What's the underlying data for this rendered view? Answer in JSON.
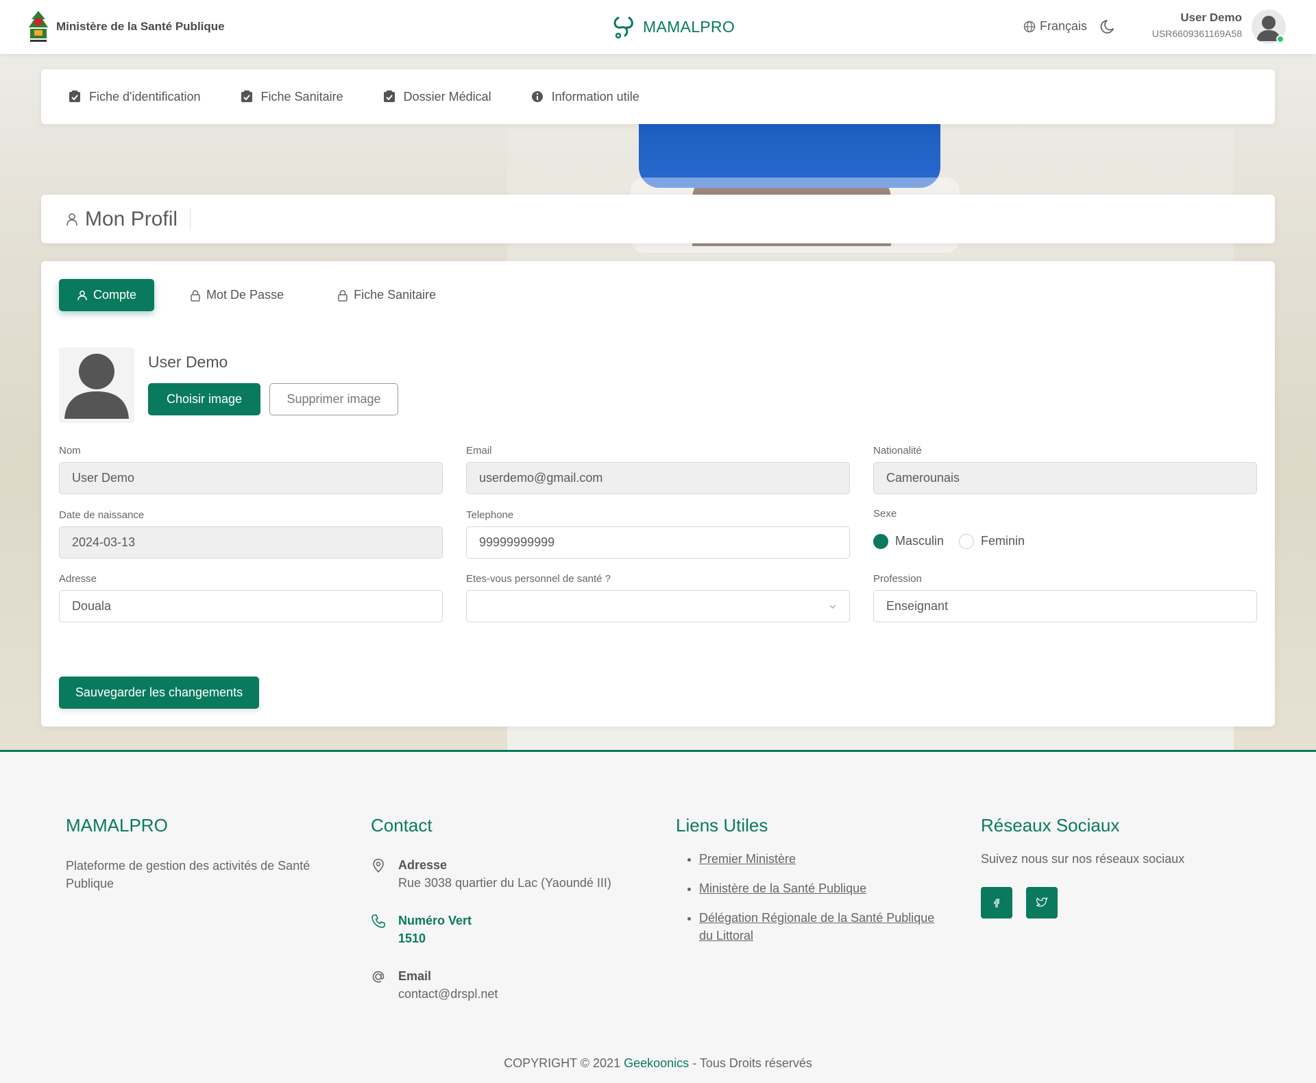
{
  "header": {
    "ministry": "Ministère de la Santé Publique",
    "brand": "MAMALPRO",
    "language": "Français",
    "user_name": "User Demo",
    "user_id": "USR6609361169A58"
  },
  "nav": [
    {
      "label": "Fiche d'identification",
      "icon": "check-square-icon"
    },
    {
      "label": "Fiche Sanitaire",
      "icon": "check-square-icon"
    },
    {
      "label": "Dossier Médical",
      "icon": "check-square-icon"
    },
    {
      "label": "Information utile",
      "icon": "info-icon"
    }
  ],
  "page_title": "Mon Profil",
  "tabs": [
    {
      "label": "Compte",
      "active": true,
      "icon": "user-icon"
    },
    {
      "label": "Mot De Passe",
      "active": false,
      "icon": "lock-icon"
    },
    {
      "label": "Fiche Sanitaire",
      "active": false,
      "icon": "lock-icon"
    }
  ],
  "profile": {
    "name": "User Demo",
    "choose_image": "Choisir image",
    "remove_image": "Supprimer image"
  },
  "form": {
    "nom": {
      "label": "Nom",
      "value": "User Demo"
    },
    "email": {
      "label": "Email",
      "value": "userdemo@gmail.com"
    },
    "nationalite": {
      "label": "Nationalité",
      "value": "Camerounais"
    },
    "naissance": {
      "label": "Date de naissance",
      "value": "2024-03-13"
    },
    "telephone": {
      "label": "Telephone",
      "value": "99999999999"
    },
    "sexe": {
      "label": "Sexe",
      "options": [
        "Masculin",
        "Feminin"
      ],
      "selected": "Masculin"
    },
    "adresse": {
      "label": "Adresse",
      "value": "Douala"
    },
    "personnel": {
      "label": "Etes-vous personnel de santé ?",
      "value": ""
    },
    "profession": {
      "label": "Profession",
      "value": "Enseignant"
    }
  },
  "save_button": "Sauvegarder les changements",
  "footer": {
    "about_title": "MAMALPRO",
    "about_text": "Plateforme de gestion des activités de Santé Publique",
    "contact_title": "Contact",
    "address_label": "Adresse",
    "address_value": "Rue 3038 quartier du Lac (Yaoundé III)",
    "phone_label": "Numéro Vert",
    "phone_value": "1510",
    "email_label": "Email",
    "email_value": "contact@drspl.net",
    "links_title": "Liens Utiles",
    "links": [
      "Premier Ministère",
      "Ministère de la Santé Publique",
      "Délégation Régionale de la Santé Publique du Littoral"
    ],
    "social_title": "Réseaux Sociaux",
    "social_text": "Suivez nous sur nos réseaux sociaux",
    "copyright_prefix": "COPYRIGHT © 2021",
    "copyright_company": "Geekoonics",
    "copyright_suffix": "- Tous Droits réservés"
  },
  "colors": {
    "primary": "#0a7a5e",
    "online": "#28c76f"
  }
}
